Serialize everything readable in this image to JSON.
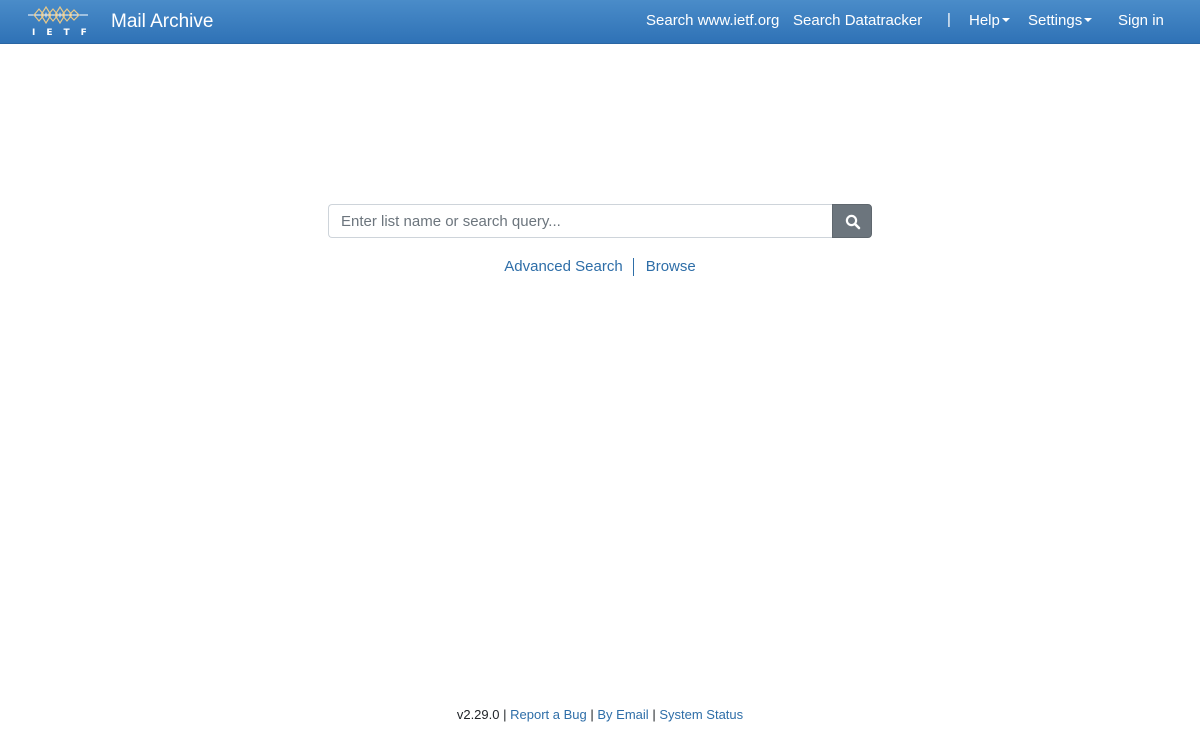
{
  "header": {
    "logo_text": "IETF",
    "app_title": "Mail Archive",
    "nav": {
      "search_ietf": "Search www.ietf.org",
      "search_datatracker": "Search Datatracker",
      "separator": "|",
      "help": "Help",
      "settings": "Settings",
      "sign_in": "Sign in"
    }
  },
  "search": {
    "placeholder": "Enter list name or search query...",
    "value": "",
    "button_icon": "search-icon"
  },
  "links": {
    "advanced_search": "Advanced Search",
    "browse": "Browse"
  },
  "footer": {
    "version": "v2.29.0",
    "sep1": "|",
    "report_bug": "Report a Bug",
    "sep2": "|",
    "by_email": "By Email",
    "sep3": "|",
    "system_status": "System Status"
  },
  "colors": {
    "navbar": "#3b80c1",
    "link": "#2e6ea8",
    "search_button": "#6c757d"
  }
}
